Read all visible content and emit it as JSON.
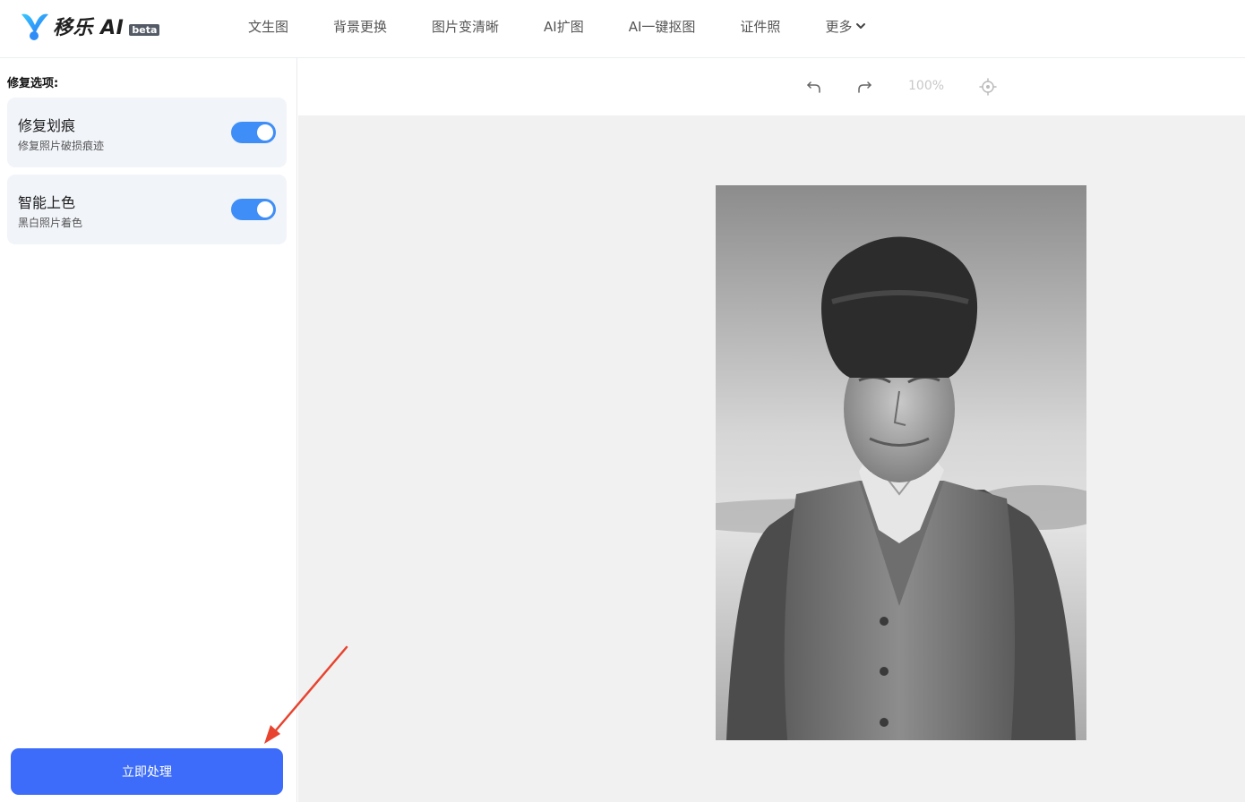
{
  "brand": {
    "name": "移乐 AI",
    "badge": "beta"
  },
  "nav": {
    "items": [
      "文生图",
      "背景更换",
      "图片变清晰",
      "AI扩图",
      "AI一键抠图",
      "证件照"
    ],
    "more_label": "更多"
  },
  "sidebar": {
    "section_title": "修复选项:",
    "options": [
      {
        "title": "修复划痕",
        "desc": "修复照片破损痕迹",
        "enabled": true
      },
      {
        "title": "智能上色",
        "desc": "黑白照片着色",
        "enabled": true
      }
    ],
    "process_label": "立即处理"
  },
  "toolbar": {
    "zoom": "100%",
    "undo_icon": "undo-icon",
    "redo_icon": "redo-icon",
    "locate_icon": "crosshair-icon"
  },
  "colors": {
    "accent": "#3c6cf9",
    "toggle_on": "#3f8ef7",
    "card_bg": "#f1f4f9",
    "workspace_bg": "#f1f1f2",
    "annotation": "#e8432f"
  }
}
